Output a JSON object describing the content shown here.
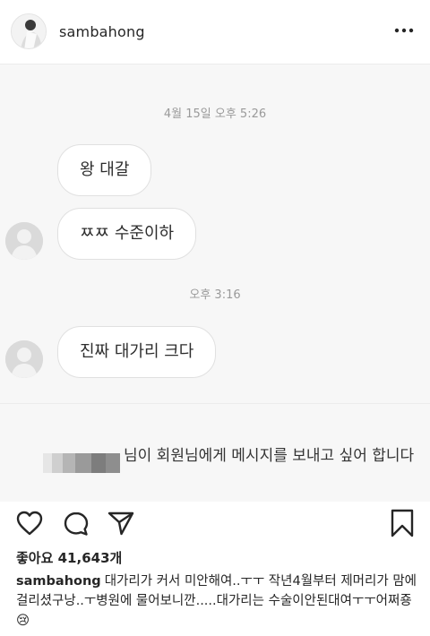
{
  "post": {
    "username": "sambahong",
    "likes_text": "좋아요 41,643개",
    "caption": "대가리가 커서 미안해여..ㅜㅜ 작년4월부터 제머리가 맘에걸리셨구낭..ㅜ병원에 물어보니깐.....대가리는 수술이안된대여ㅜㅜ어쩌죵😢"
  },
  "dm": {
    "timestamp1": "4월 15일 오후 5:26",
    "messages_group1": [
      "왕 대갈",
      "ㅉㅉ 수준이하"
    ],
    "timestamp2": "오후 3:16",
    "messages_group2": [
      "진짜 대가리 크다"
    ],
    "request_text": "님이 회원님에게 메시지를 보내고 싶어 합니다"
  },
  "icons": {
    "more": "more-options-icon",
    "like": "heart-icon",
    "comment": "comment-icon",
    "share": "paper-plane-icon",
    "save": "bookmark-icon"
  }
}
